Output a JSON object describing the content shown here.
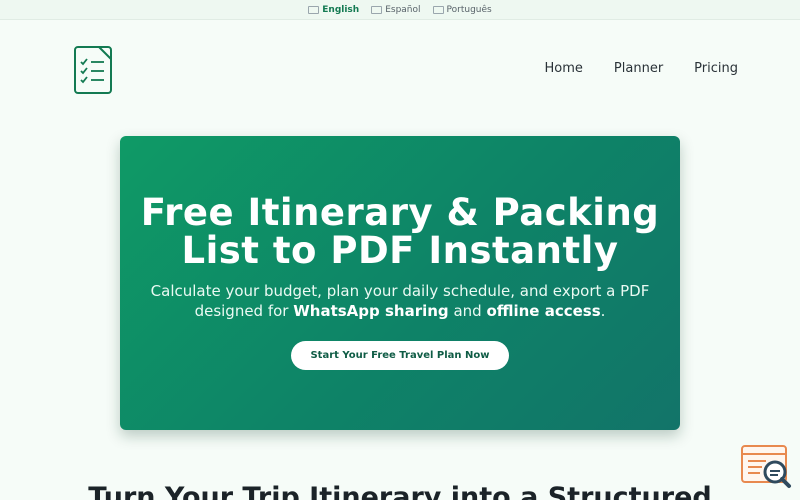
{
  "languages": [
    {
      "label": "English",
      "active": true
    },
    {
      "label": "Español",
      "active": false
    },
    {
      "label": "Português",
      "active": false
    }
  ],
  "nav": {
    "items": [
      "Home",
      "Planner",
      "Pricing"
    ]
  },
  "hero": {
    "title_line1": "Free Itinerary & Packing",
    "title_line2": "List to PDF Instantly",
    "subtitle_part1": "Calculate your budget, plan your daily schedule, and export a PDF designed for ",
    "subtitle_bold1": "WhatsApp sharing",
    "subtitle_part2": " and ",
    "subtitle_bold2": "offline access",
    "subtitle_part3": ".",
    "cta_label": "Start Your Free Travel Plan Now"
  },
  "section": {
    "title": "Turn Your Trip Itinerary into a Structured"
  },
  "icons": {
    "logo": "checklist-icon",
    "widget": "search-document-icon"
  },
  "colors": {
    "brand": "#137a52",
    "hero_start": "#0f9a66",
    "hero_end": "#127469",
    "widget": "#e8894f"
  }
}
